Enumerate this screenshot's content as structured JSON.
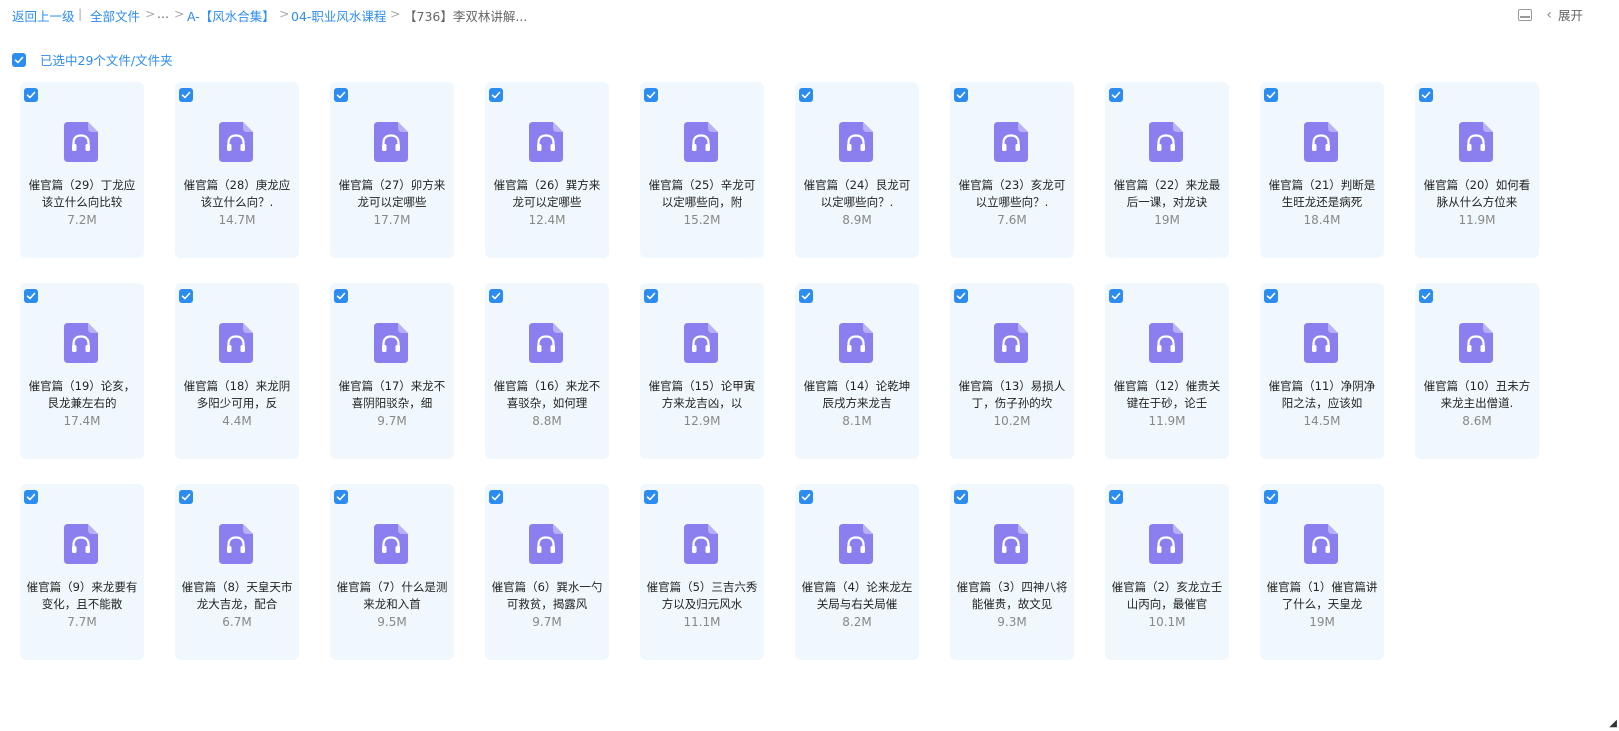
{
  "breadcrumb": {
    "back": "返回上一级",
    "sep1": "|",
    "all_files": "全部文件",
    "sep2": ">",
    "ellipsis": "...",
    "sep3": ">",
    "folder1": "A-【风水合集】",
    "sep4": ">",
    "folder2": "04-职业风水课程",
    "sep5": ">",
    "current": "【736】李双林讲解..."
  },
  "toolbar": {
    "expand_label": "展开",
    "chevron": "‹"
  },
  "selection": {
    "label": "已选中29个文件/文件夹"
  },
  "files": [
    {
      "name": "催官篇（29）丁龙应该立什么向比较",
      "size": "7.2M"
    },
    {
      "name": "催官篇（28）庚龙应该立什么向？.",
      "size": "14.7M"
    },
    {
      "name": "催官篇（27）卯方来龙可以定哪些",
      "size": "17.7M"
    },
    {
      "name": "催官篇（26）巽方来龙可以定哪些",
      "size": "12.4M"
    },
    {
      "name": "催官篇（25）辛龙可以定哪些向，附",
      "size": "15.2M"
    },
    {
      "name": "催官篇（24）艮龙可以定哪些向？.",
      "size": "8.9M"
    },
    {
      "name": "催官篇（23）亥龙可以立哪些向？.",
      "size": "7.6M"
    },
    {
      "name": "催官篇（22）来龙最后一课，对龙诀",
      "size": "19M"
    },
    {
      "name": "催官篇（21）判断是生旺龙还是病死",
      "size": "18.4M"
    },
    {
      "name": "催官篇（20）如何看脉从什么方位来",
      "size": "11.9M"
    },
    {
      "name": "催官篇（19）论亥，艮龙兼左右的",
      "size": "17.4M"
    },
    {
      "name": "催官篇（18）来龙阴多阳少可用，反",
      "size": "4.4M"
    },
    {
      "name": "催官篇（17）来龙不喜阴阳驳杂，细",
      "size": "9.7M"
    },
    {
      "name": "催官篇（16）来龙不喜驳杂，如何理",
      "size": "8.8M"
    },
    {
      "name": "催官篇（15）论甲寅方来龙吉凶，以",
      "size": "12.9M"
    },
    {
      "name": "催官篇（14）论乾坤辰戌方来龙吉",
      "size": "8.1M"
    },
    {
      "name": "催官篇（13）易损人丁，伤子孙的坎",
      "size": "10.2M"
    },
    {
      "name": "催官篇（12）催贵关键在于砂，论壬",
      "size": "11.9M"
    },
    {
      "name": "催官篇（11）净阴净阳之法，应该如",
      "size": "14.5M"
    },
    {
      "name": "催官篇（10）丑未方来龙主出僧道.",
      "size": "8.6M"
    },
    {
      "name": "催官篇（9）来龙要有变化，且不能散",
      "size": "7.7M"
    },
    {
      "name": "催官篇（8）天皇天市龙大吉龙，配合",
      "size": "6.7M"
    },
    {
      "name": "催官篇（7）什么是测来龙和入首",
      "size": "9.5M"
    },
    {
      "name": "催官篇（6）巽水一勺可救贫，揭露风",
      "size": "9.7M"
    },
    {
      "name": "催官篇（5）三吉六秀方以及归元风水",
      "size": "11.1M"
    },
    {
      "name": "催官篇（4）论来龙左关局与右关局催",
      "size": "8.2M"
    },
    {
      "name": "催官篇（3）四神八将能催贵，故文见",
      "size": "9.3M"
    },
    {
      "name": "催官篇（2）亥龙立壬山丙向，最催官",
      "size": "10.1M"
    },
    {
      "name": "催官篇（1）催官篇讲了什么，天皇龙",
      "size": "19M"
    }
  ],
  "colors": {
    "accent": "#2d8cf0",
    "card_bg": "#f0f8fd",
    "icon": "#8b7ff0"
  }
}
